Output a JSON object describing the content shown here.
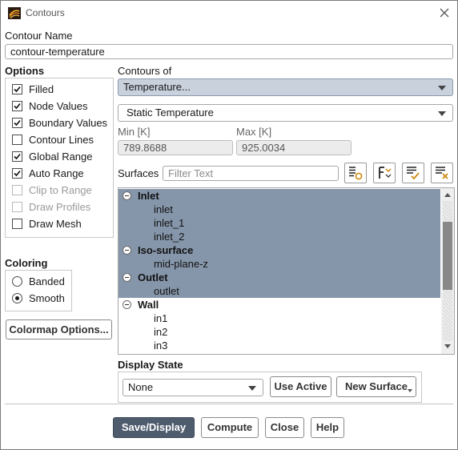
{
  "window": {
    "title": "Contours",
    "close_icon": "close-icon"
  },
  "contour_name": {
    "label": "Contour Name",
    "value": "contour-temperature"
  },
  "options": {
    "label": "Options",
    "items": [
      {
        "label": "Filled",
        "checked": true,
        "enabled": true
      },
      {
        "label": "Node Values",
        "checked": true,
        "enabled": true
      },
      {
        "label": "Boundary Values",
        "checked": true,
        "enabled": true
      },
      {
        "label": "Contour Lines",
        "checked": false,
        "enabled": true
      },
      {
        "label": "Global Range",
        "checked": true,
        "enabled": true
      },
      {
        "label": "Auto Range",
        "checked": true,
        "enabled": true
      },
      {
        "label": "Clip to Range",
        "checked": false,
        "enabled": false
      },
      {
        "label": "Draw Profiles",
        "checked": false,
        "enabled": false
      },
      {
        "label": "Draw Mesh",
        "checked": false,
        "enabled": true
      }
    ]
  },
  "coloring": {
    "label": "Coloring",
    "options": [
      {
        "label": "Banded",
        "selected": false
      },
      {
        "label": "Smooth",
        "selected": true
      }
    ],
    "colormap_button": "Colormap Options..."
  },
  "contours_of": {
    "label": "Contours of",
    "category": "Temperature...",
    "quantity": "Static Temperature"
  },
  "range": {
    "min_label": "Min [K]",
    "min_value": "789.8688",
    "max_label": "Max [K]",
    "max_value": "925.0034"
  },
  "surfaces": {
    "label": "Surfaces",
    "filter_placeholder": "Filter Text",
    "tool_icons": [
      "new-surface-icon",
      "type-filter-icon",
      "select-all-icon",
      "deselect-all-icon"
    ],
    "tree": [
      {
        "type": "group",
        "label": "Inlet",
        "selected": true
      },
      {
        "type": "item",
        "label": "inlet",
        "selected": true
      },
      {
        "type": "item",
        "label": "inlet_1",
        "selected": true
      },
      {
        "type": "item",
        "label": "inlet_2",
        "selected": true
      },
      {
        "type": "group",
        "label": "Iso-surface",
        "selected": true
      },
      {
        "type": "item",
        "label": "mid-plane-z",
        "selected": true
      },
      {
        "type": "group",
        "label": "Outlet",
        "selected": true
      },
      {
        "type": "item",
        "label": "outlet",
        "selected": true
      },
      {
        "type": "group",
        "label": "Wall",
        "selected": false
      },
      {
        "type": "item",
        "label": "in1",
        "selected": false
      },
      {
        "type": "item",
        "label": "in2",
        "selected": false
      },
      {
        "type": "item",
        "label": "in3",
        "selected": false
      }
    ]
  },
  "display_state": {
    "label": "Display State",
    "value": "None",
    "use_active": "Use Active",
    "new_surface": "New Surface"
  },
  "footer": {
    "save_display": "Save/Display",
    "compute": "Compute",
    "close": "Close",
    "help": "Help"
  },
  "colors": {
    "selection": "#8696aa",
    "primary_button": "#4e5c6e",
    "highlight_select": "#c9d1dd"
  }
}
